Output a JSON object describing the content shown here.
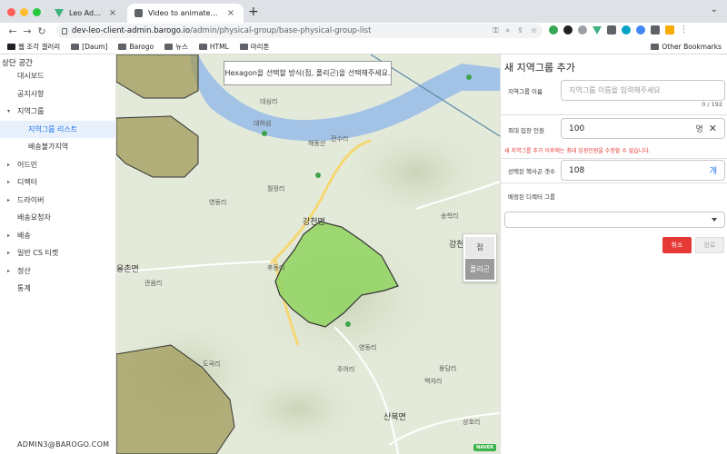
{
  "browser": {
    "tabs": [
      {
        "title": "Leo Admin Web",
        "icon": "vue-logo-icon",
        "active": false
      },
      {
        "title": "Video to animated GIF converter",
        "icon": "document-icon",
        "active": true
      }
    ],
    "new_tab": "+",
    "url_host": "dev-leo-client-admin.barogo.io",
    "url_path": "/admin/physical-group/base-physical-group-list",
    "bookmarks": [
      "웹 조각 갤러리",
      "[Daum]",
      "Barogo",
      "뉴스",
      "HTML",
      "마리톤"
    ],
    "other_bookmarks": "Other Bookmarks"
  },
  "sidebar": {
    "brand": "상단 공간",
    "items": [
      {
        "label": "대시보드",
        "level": 0,
        "arrow": ""
      },
      {
        "label": "공지사항",
        "level": 0,
        "arrow": ""
      },
      {
        "label": "지역그룹",
        "level": 0,
        "arrow": "▾"
      },
      {
        "label": "지역그룹 리스트",
        "level": 1,
        "arrow": "",
        "selected": true
      },
      {
        "label": "배송불가지역",
        "level": 1,
        "arrow": ""
      },
      {
        "label": "어드민",
        "level": 0,
        "arrow": "▸"
      },
      {
        "label": "디렉터",
        "level": 0,
        "arrow": "▸"
      },
      {
        "label": "드라이버",
        "level": 0,
        "arrow": "▸"
      },
      {
        "label": "배송요청자",
        "level": 0,
        "arrow": ""
      },
      {
        "label": "배송",
        "level": 0,
        "arrow": "▸"
      },
      {
        "label": "일반 CS 티켓",
        "level": 0,
        "arrow": "▸"
      },
      {
        "label": "정산",
        "level": 0,
        "arrow": "▸"
      },
      {
        "label": "통계",
        "level": 0,
        "arrow": ""
      }
    ],
    "user": "ADMIN3@BAROGO.COM"
  },
  "map": {
    "tooltip": "Hexagon을 선택할 방식(점, 폴리곤)을 선택해주세요.",
    "mode_point": "점",
    "mode_polygon": "폴리곤",
    "labels": [
      {
        "text": "대심리",
        "pos": "a"
      },
      {
        "text": "대하섬",
        "pos": "b"
      },
      {
        "text": "전수리",
        "pos": "c"
      },
      {
        "text": "해동산",
        "pos": "d"
      },
      {
        "text": "월정리",
        "pos": "e"
      },
      {
        "text": "영동리",
        "pos": "f"
      },
      {
        "text": "강천면",
        "pos": "g"
      },
      {
        "text": "율촌면",
        "pos": "h"
      },
      {
        "text": "관음리",
        "pos": "i"
      },
      {
        "text": "송학리",
        "pos": "j"
      },
      {
        "text": "강천",
        "pos": "k"
      },
      {
        "text": "영동리",
        "pos": "l"
      },
      {
        "text": "주어리",
        "pos": "m"
      },
      {
        "text": "산북면",
        "pos": "n"
      },
      {
        "text": "상호리",
        "pos": "o"
      },
      {
        "text": "백자리",
        "pos": "p"
      },
      {
        "text": "용담리",
        "pos": "q"
      },
      {
        "text": "도곡리",
        "pos": "r"
      },
      {
        "text": "후동리",
        "pos": "s"
      }
    ],
    "attribution": "NAVER"
  },
  "panel": {
    "title": "새 지역그룹 추가",
    "name_label": "지역그룹 이름",
    "name_placeholder": "지역그룹 이름을 입력해주세요",
    "name_counter": "0 / 192",
    "capacity_label": "최대 입장 인원",
    "capacity_value": "100",
    "capacity_unit": "명",
    "warning": "새 지역그룹 추가 이후에는 최대 입장인원을 수정할 수 없습니다.",
    "hex_count_label": "선택된 헥사곤 갯수",
    "hex_count_value": "108",
    "hex_count_unit": "개",
    "director_label": "배정된 디렉터 그룹",
    "director_value": "",
    "cancel": "취소",
    "done": "완료"
  },
  "colors": {
    "accent": "#1a73e8",
    "danger": "#e53935",
    "hex_selected": "#8fd45f",
    "hex_existing": "#a09a5a"
  }
}
